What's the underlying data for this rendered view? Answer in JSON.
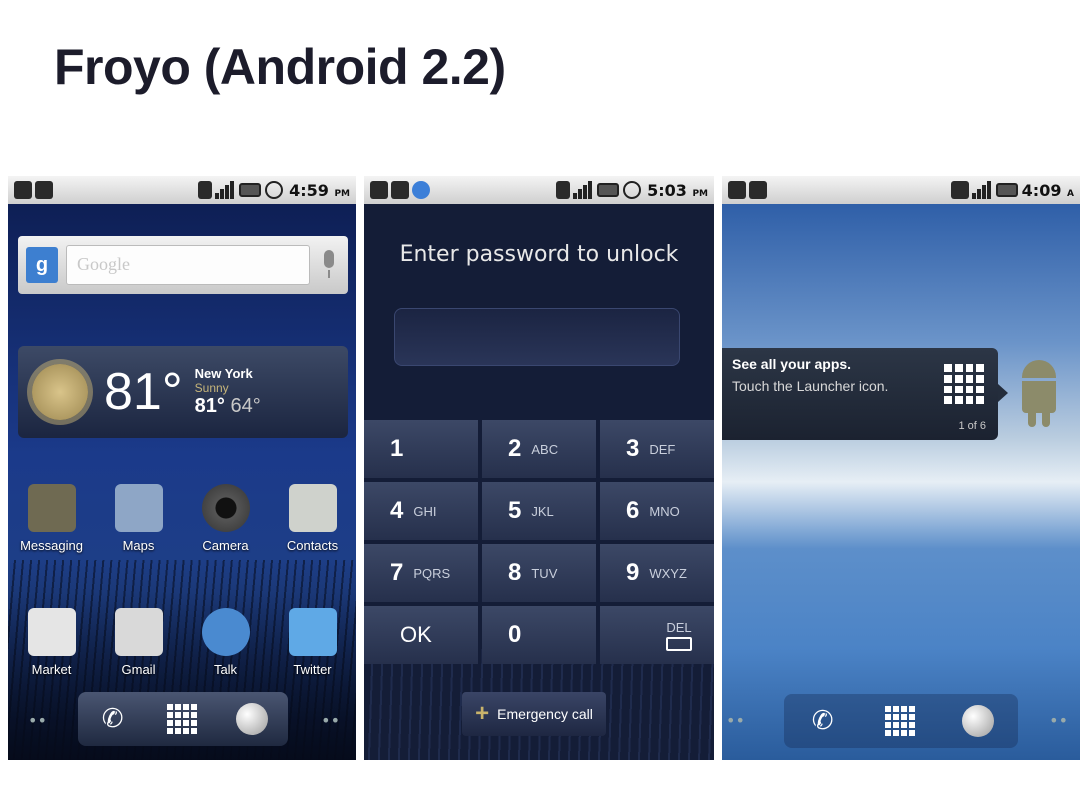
{
  "slide": {
    "title": "Froyo (Android 2.2)"
  },
  "screen1": {
    "status_time": "4:59",
    "status_ampm": "PM",
    "search_placeholder": "Google",
    "search_button_label": "g",
    "weather": {
      "temp": "81°",
      "city": "New York",
      "condition": "Sunny",
      "high": "81°",
      "low": "64°"
    },
    "apps_row1": [
      {
        "label": "Messaging",
        "color": "#6f6a52"
      },
      {
        "label": "Maps",
        "color": "#8ea6c6"
      },
      {
        "label": "Camera",
        "color": "#3a3a3a"
      },
      {
        "label": "Contacts",
        "color": "#cfd2cc"
      }
    ],
    "apps_row2": [
      {
        "label": "Market",
        "color": "#e5e5e5"
      },
      {
        "label": "Gmail",
        "color": "#d9d9d9"
      },
      {
        "label": "Talk",
        "color": "#4a8ad0"
      },
      {
        "label": "Twitter",
        "color": "#5fa9e6"
      }
    ],
    "page_dots": "••"
  },
  "screen2": {
    "status_time": "5:03",
    "status_ampm": "PM",
    "prompt": "Enter password to unlock",
    "keys": [
      {
        "num": "1",
        "letters": ""
      },
      {
        "num": "2",
        "letters": "ABC"
      },
      {
        "num": "3",
        "letters": "DEF"
      },
      {
        "num": "4",
        "letters": "GHI"
      },
      {
        "num": "5",
        "letters": "JKL"
      },
      {
        "num": "6",
        "letters": "MNO"
      },
      {
        "num": "7",
        "letters": "PQRS"
      },
      {
        "num": "8",
        "letters": "TUV"
      },
      {
        "num": "9",
        "letters": "WXYZ"
      }
    ],
    "ok_label": "OK",
    "zero_label": "0",
    "del_label": "DEL",
    "emergency_label": "Emergency call"
  },
  "screen3": {
    "status_time": "4:09",
    "status_ampm": "A",
    "tip_title": "See all your apps.",
    "tip_body": "Touch the Launcher icon.",
    "tip_page": "1 of 6",
    "page_dots": "••"
  }
}
